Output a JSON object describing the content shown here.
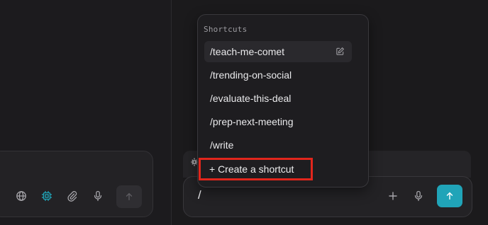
{
  "shortcuts_menu": {
    "title": "Shortcuts",
    "items": [
      {
        "label": "/teach-me-comet"
      },
      {
        "label": "/trending-on-social"
      },
      {
        "label": "/evaluate-this-deal"
      },
      {
        "label": "/prep-next-meeting"
      },
      {
        "label": "/write"
      }
    ],
    "create_label": "+ Create a shortcut",
    "highlight_color": "#e1261c"
  },
  "composer": {
    "input_value": "/",
    "send_color": "#20a4b8"
  },
  "icons": {
    "left_toolbar": [
      "globe-icon",
      "chip-icon",
      "paperclip-icon",
      "microphone-icon",
      "arrow-up-icon"
    ],
    "right_toolbar": [
      "plus-icon",
      "microphone-icon",
      "arrow-up-icon"
    ],
    "item_action": "edit-icon"
  }
}
